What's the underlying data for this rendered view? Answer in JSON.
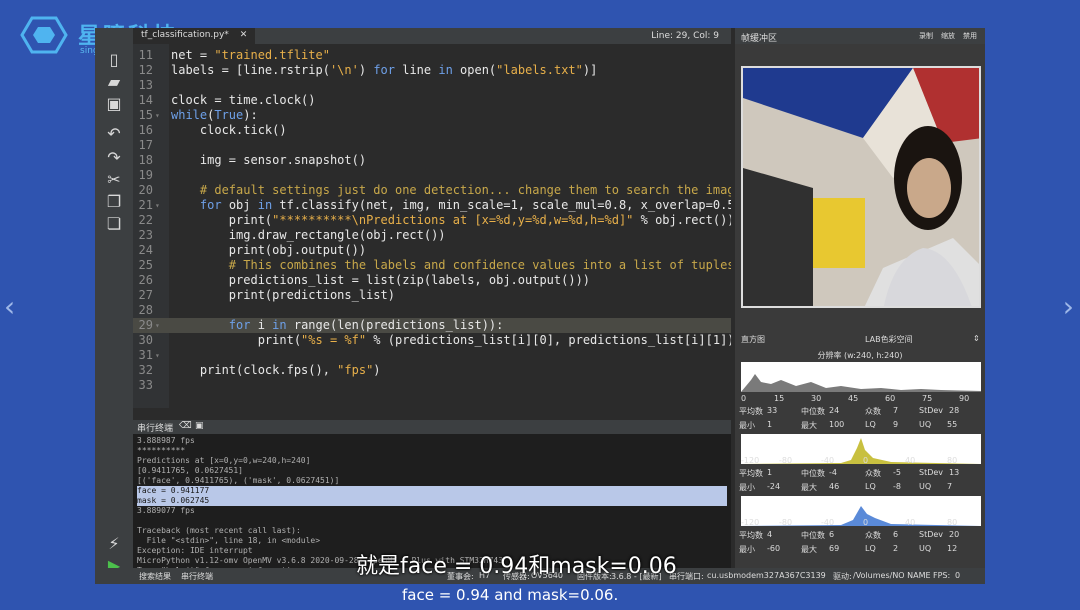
{
  "logo": {
    "brand": "星瞳科技",
    "sub": "singtown.com",
    "icon": "hexagon-logo-icon"
  },
  "tab": {
    "filename": "tf_classification.py*",
    "close": "✕"
  },
  "status_top": {
    "linecol": "Line: 29, Col: 9"
  },
  "code_lines": [
    {
      "n": "11",
      "fold": "",
      "text": "net = \"trained.tflite\""
    },
    {
      "n": "12",
      "fold": "",
      "text": "labels = [line.rstrip('\\n') for line in open(\"labels.txt\")]"
    },
    {
      "n": "13",
      "fold": "",
      "text": ""
    },
    {
      "n": "14",
      "fold": "",
      "text": "clock = time.clock()"
    },
    {
      "n": "15",
      "fold": "▾",
      "text": "while(True):"
    },
    {
      "n": "16",
      "fold": "",
      "text": "    clock.tick()"
    },
    {
      "n": "17",
      "fold": "",
      "text": ""
    },
    {
      "n": "18",
      "fold": "",
      "text": "    img = sensor.snapshot()"
    },
    {
      "n": "19",
      "fold": "",
      "text": ""
    },
    {
      "n": "20",
      "fold": "",
      "text": "    # default settings just do one detection... change them to search the image..."
    },
    {
      "n": "21",
      "fold": "▾",
      "text": "    for obj in tf.classify(net, img, min_scale=1, scale_mul=0.8, x_overlap=0.5, y_ov"
    },
    {
      "n": "22",
      "fold": "",
      "text": "        print(\"**********\\nPredictions at [x=%d,y=%d,w=%d,h=%d]\" % obj.rect())"
    },
    {
      "n": "23",
      "fold": "",
      "text": "        img.draw_rectangle(obj.rect())"
    },
    {
      "n": "24",
      "fold": "",
      "text": "        print(obj.output())"
    },
    {
      "n": "25",
      "fold": "",
      "text": "        # This combines the labels and confidence values into a list of tuples"
    },
    {
      "n": "26",
      "fold": "",
      "text": "        predictions_list = list(zip(labels, obj.output()))"
    },
    {
      "n": "27",
      "fold": "",
      "text": "        print(predictions_list)"
    },
    {
      "n": "28",
      "fold": "",
      "text": ""
    },
    {
      "n": "29",
      "fold": "▾",
      "text": "        for i in range(len(predictions_list)):"
    },
    {
      "n": "30",
      "fold": "",
      "text": "            print(\"%s = %f\" % (predictions_list[i][0], predictions_list[i][1]))"
    },
    {
      "n": "31",
      "fold": "▾",
      "text": ""
    },
    {
      "n": "32",
      "fold": "",
      "text": "    print(clock.fps(), \"fps\")"
    },
    {
      "n": "33",
      "fold": "",
      "text": ""
    }
  ],
  "terminal": {
    "title": "串行终端",
    "lines": [
      "3.888987 fps",
      "**********",
      "Predictions at [x=0,y=0,w=240,h=240]",
      "[0.9411765, 0.0627451]",
      "[('face', 0.9411765), ('mask', 0.0627451)]",
      "face = 0.941177",
      "mask = 0.062745",
      "3.889077 fps",
      "",
      "Traceback (most recent call last):",
      "  File \"<stdin>\", line 18, in <module>",
      "Exception: IDE interrupt",
      "MicroPython v1.12-omv OpenMV v3.6.8 2020-09-28; OpenMV 4 Plus with STM32H743",
      "Type \"help()\" for more information."
    ]
  },
  "statusbar": {
    "search_tab": "搜索结果",
    "terminal_tab": "串行终端",
    "board_label": "董事会:",
    "board": "H7",
    "sensor_label": "传感器:",
    "sensor": "OV5640",
    "firmware_label": "固件版本:",
    "firmware": "3.6.8 - [最新]",
    "port_label": "串行端口:",
    "port": "cu.usbmodem327A367C3139",
    "drive_label": "驱动:",
    "drive": "/Volumes/NO NAME",
    "fps_label": "FPS:",
    "fps": "0"
  },
  "frame_panel": {
    "title": "帧缓冲区",
    "record": "录制",
    "zoom": "缩放",
    "disable": "禁用"
  },
  "histogram": {
    "title": "直方图",
    "colorspace": "LAB色彩空间",
    "resolution": "分辨率 (w:240, h:240)",
    "l_axis": [
      "0",
      "15",
      "30",
      "45",
      "60",
      "75",
      "90"
    ],
    "ab_axis": [
      "-120",
      "-80",
      "-40",
      "0",
      "40",
      "80"
    ],
    "channels": [
      {
        "mean": "33",
        "median": "24",
        "mode": "7",
        "stdev": "28",
        "min": "1",
        "max": "100",
        "lq": "9",
        "uq": "55"
      },
      {
        "mean": "1",
        "median": "-4",
        "mode": "-5",
        "stdev": "13",
        "min": "-24",
        "max": "46",
        "lq": "-8",
        "uq": "7"
      },
      {
        "mean": "4",
        "median": "6",
        "mode": "6",
        "stdev": "20",
        "min": "-60",
        "max": "69",
        "lq": "2",
        "uq": "12"
      }
    ],
    "labels": {
      "mean": "平均数",
      "median": "中位数",
      "mode": "众数",
      "stdev": "StDev",
      "min": "最小",
      "max": "最大",
      "lq": "LQ",
      "uq": "UQ"
    }
  },
  "subtitles": {
    "cn": "就是face = 0.94和mask=0.06",
    "en": "face = 0.94 and mask=0.06."
  }
}
